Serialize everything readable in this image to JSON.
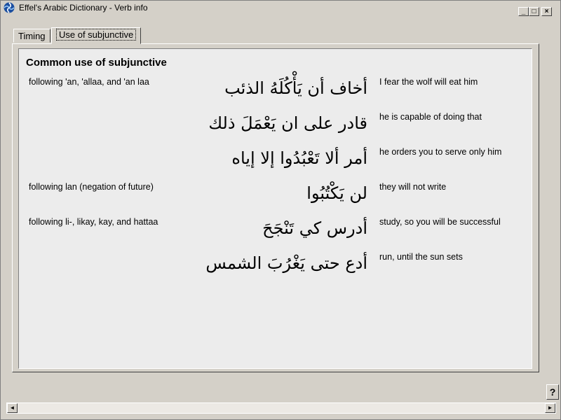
{
  "window": {
    "title": "Effel's Arabic Dictionary - Verb info",
    "controls": {
      "minimize": "_",
      "maximize": "□",
      "close": "×"
    }
  },
  "tabs": [
    {
      "label": "Timing"
    },
    {
      "label": "Use of subjunctive"
    }
  ],
  "section": {
    "heading": "Common use of subjunctive",
    "rows": [
      {
        "rule": "following 'an, 'allaa, and 'an laa",
        "arabic": "أخاف أن يَأْكُلَهُ الذئب",
        "english": "I fear the wolf will eat him"
      },
      {
        "rule": "",
        "arabic": "قادر على ان يَعْمَلَ ذلك",
        "english": "he is capable of doing that"
      },
      {
        "rule": "",
        "arabic": "أمر ألا تَعْبُدُوا إلا إياه",
        "english": "he orders you to serve only him"
      },
      {
        "rule": "following lan (negation of future)",
        "arabic": "لن يَكْتُبُوا",
        "english": "they will not write"
      },
      {
        "rule": "following li-, likay, kay, and hattaa",
        "arabic": "أدرس كي تَنْجَحَ",
        "english": "study, so you will be successful"
      },
      {
        "rule": "",
        "arabic": "أدع حتى يَغْرُبَ الشمس",
        "english": "run, until the sun sets"
      }
    ]
  },
  "help_button": "?",
  "scrollbar": {
    "left_arrow": "◄",
    "right_arrow": "►"
  },
  "colors": {
    "face": "#d4d0c8",
    "panel": "#ececec",
    "icon_blue": "#1c4fa0"
  }
}
